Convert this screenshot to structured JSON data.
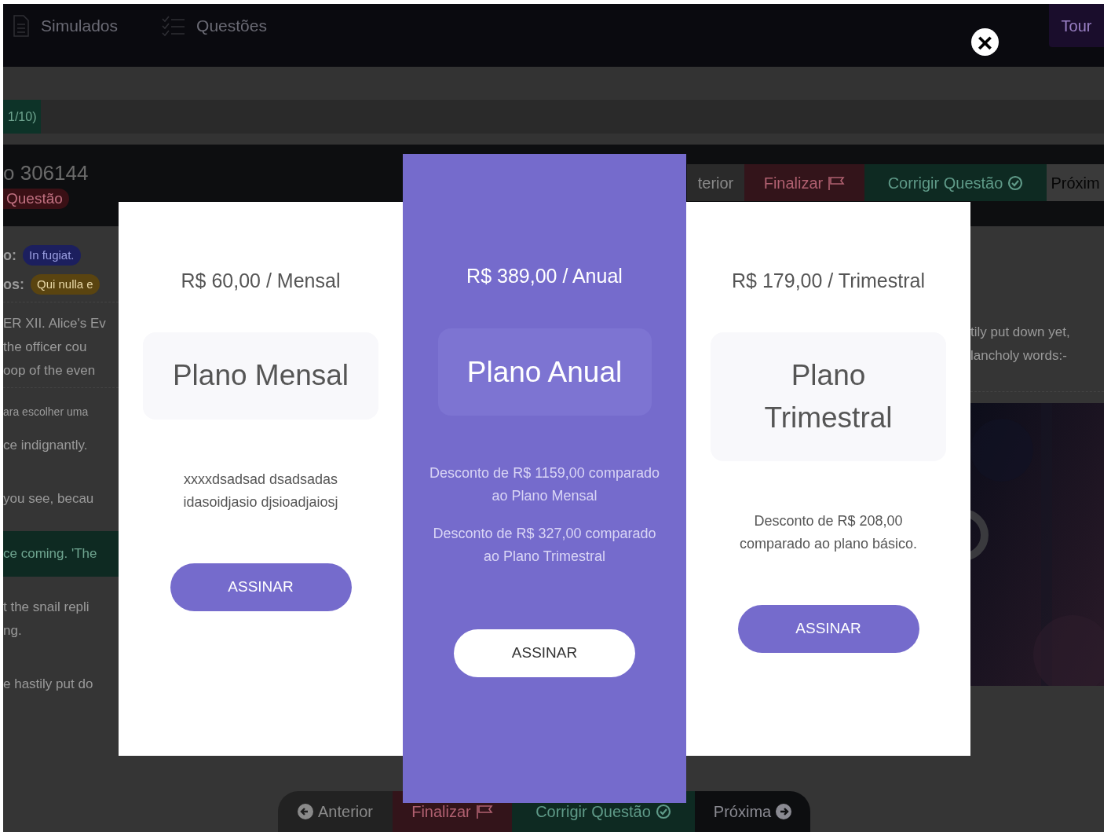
{
  "navbar": {
    "items": [
      {
        "label": "Simulados"
      },
      {
        "label": "Questões"
      }
    ],
    "tour_button": "Tour"
  },
  "progress_badge": "1/10)",
  "question": {
    "title": "o 306144",
    "tag": "Questão"
  },
  "top_actions": [
    {
      "label": "terior"
    },
    {
      "label": "Finalizar"
    },
    {
      "label": "Corrigir Questão"
    },
    {
      "label": "Próxim"
    }
  ],
  "left_content": [
    {
      "kind": "info",
      "label": "o:",
      "pill": "In fugiat.",
      "color": "#1c1f5e"
    },
    {
      "kind": "info",
      "label": "os:",
      "pill": "Qui nulla e",
      "color": "#5a4410"
    },
    {
      "kind": "divider"
    },
    {
      "kind": "text",
      "lines": [
        "ER XII. Alice's Ev",
        "the officer cou",
        "oop of the even"
      ]
    },
    {
      "kind": "divider"
    },
    {
      "kind": "small",
      "lines": [
        "ara escolher uma"
      ]
    },
    {
      "kind": "text",
      "lines": [
        "ce indignantly."
      ]
    },
    {
      "kind": "text",
      "lines": [
        "you see, becau"
      ]
    },
    {
      "kind": "highlight",
      "lines": [
        "ce coming. 'The"
      ]
    },
    {
      "kind": "text",
      "lines": [
        "t the snail repli",
        "ng."
      ]
    },
    {
      "kind": "text",
      "lines": [
        "e hastily put do"
      ]
    }
  ],
  "right_content": {
    "lines": [
      "tily put down yet,",
      "lancholy words:-"
    ],
    "media": {
      "kind": "picture"
    }
  },
  "bottom_actions": [
    {
      "label": "Anterior"
    },
    {
      "label": "Finalizar"
    },
    {
      "label": "Corrigir Questão"
    },
    {
      "label": "Próxima"
    }
  ],
  "modal": {
    "close_button": "×",
    "plans": [
      {
        "price": "R$ 60,00 / Mensal",
        "name": "Plano Mensal",
        "descriptions": [
          "xxxxdsadsad dsadsadas idasoidjasio djsioadjaiosj"
        ],
        "button": "ASSINAR",
        "featured": false
      },
      {
        "price": "R$ 389,00 / Anual",
        "name": "Plano Anual",
        "descriptions": [
          "Desconto de R$ 1159,00 comparado ao Plano Mensal",
          "Desconto de R$ 327,00 comparado ao Plano Trimestral"
        ],
        "button": "ASSINAR",
        "featured": true
      },
      {
        "price": "R$ 179,00 / Trimestral",
        "name": "Plano Trimestral",
        "descriptions": [
          "Desconto de R$ 208,00 comparado ao plano básico."
        ],
        "button": "ASSINAR",
        "featured": false
      }
    ]
  }
}
